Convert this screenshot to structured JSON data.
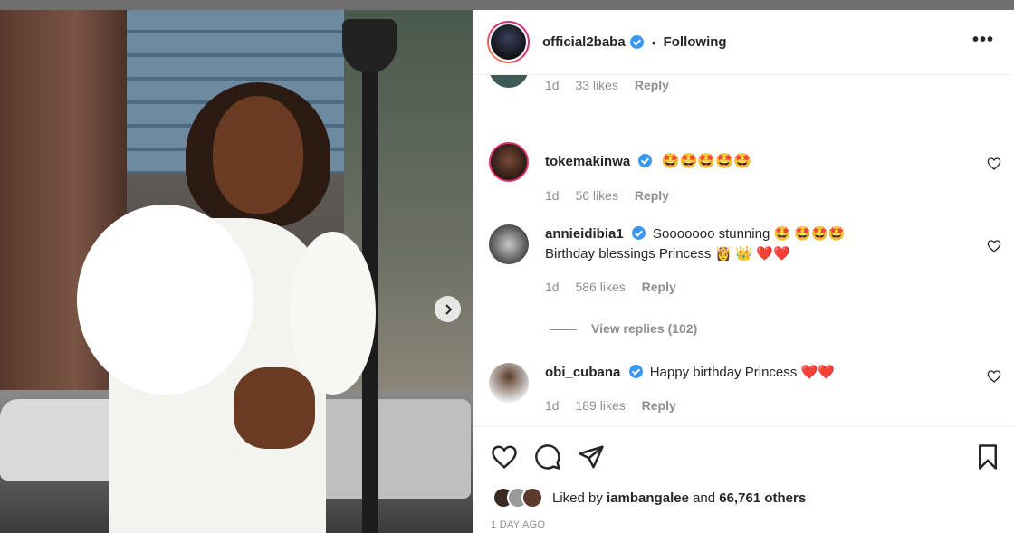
{
  "post": {
    "username": "official2baba",
    "separator": "•",
    "follow_status": "Following",
    "more_label": "•••"
  },
  "comments": [
    {
      "user": "",
      "text": "😁😊",
      "time": "1d",
      "likes": "33 likes",
      "reply": "Reply"
    },
    {
      "user": "tokemakinwa",
      "verified": true,
      "text": "🤩🤩🤩🤩🤩",
      "time": "1d",
      "likes": "56 likes",
      "reply": "Reply"
    },
    {
      "user": "annieidibia1",
      "verified": true,
      "text": "Sooooooo stunning 🤩 🤩🤩🤩",
      "text2": "Birthday blessings Princess 👸 👑 ❤️❤️",
      "time": "1d",
      "likes": "586 likes",
      "reply": "Reply",
      "view_replies": "View replies (102)"
    },
    {
      "user": "obi_cubana",
      "verified": true,
      "text": "Happy birthday Princess ❤️❤️",
      "time": "1d",
      "likes": "189 likes",
      "reply": "Reply"
    }
  ],
  "likes": {
    "prefix": "Liked by ",
    "user": "iambangalee",
    "middle": " and ",
    "count": "66,761 others"
  },
  "time_ago": "1 DAY AGO",
  "colors": {
    "verified": "#3897f0",
    "meta_gray": "#8e8e8e",
    "text": "#262626"
  }
}
